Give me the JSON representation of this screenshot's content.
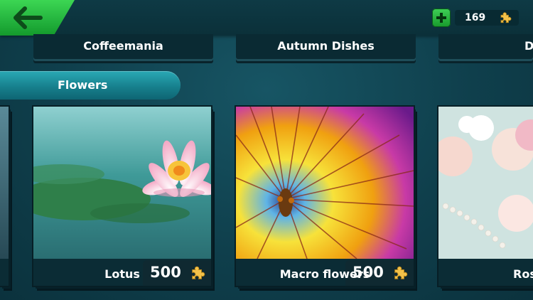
{
  "header": {
    "back_icon": "back-arrow-icon",
    "add_icon": "plus-icon",
    "coins": "169",
    "coin_icon": "puzzle-piece-icon"
  },
  "colors": {
    "accent_green": "#2bc246",
    "background": "#0f3f4c",
    "section_tab": "#17808d"
  },
  "categories": [
    {
      "label": "Coffeemania"
    },
    {
      "label": "Autumn Dishes"
    },
    {
      "label": "Dess"
    }
  ],
  "section": {
    "title": "Flowers"
  },
  "puzzles": [
    {
      "title": "Lotus",
      "pieces": "500"
    },
    {
      "title": "Macro flowers",
      "pieces": "500"
    },
    {
      "title": "Ros"
    }
  ]
}
